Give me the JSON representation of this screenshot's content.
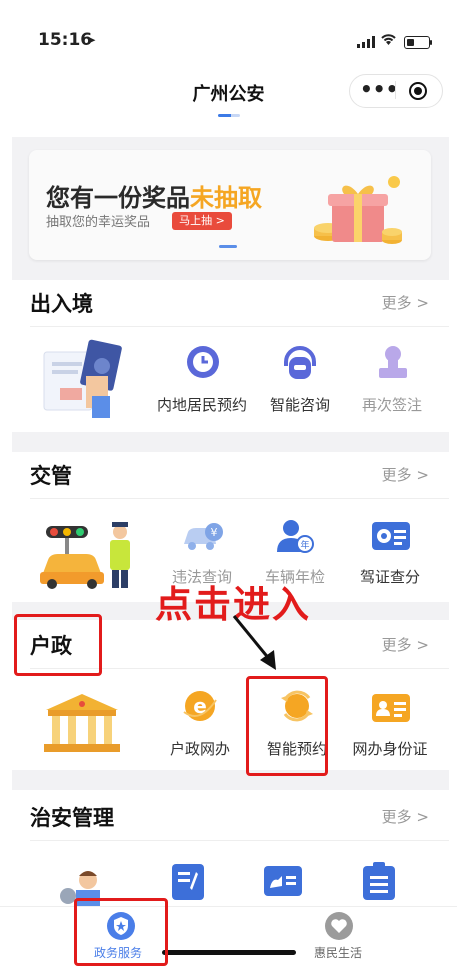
{
  "status_bar": {
    "time": "15:16",
    "location_arrow": "location-arrow-icon"
  },
  "nav": {
    "title": "广州公安",
    "more_glyph": "•••"
  },
  "banner": {
    "title_prefix": "您有一份奖品",
    "title_highlight": "未抽取",
    "subtitle": "抽取您的幸运奖品",
    "button": "马上抽 >",
    "highlight_color": "#f5a623",
    "button_color": "#e94b3c"
  },
  "sections": {
    "entry_exit": {
      "title": "出入境",
      "more": "更多 >",
      "items": [
        {
          "label": "内地居民预约"
        },
        {
          "label": "智能咨询"
        },
        {
          "label": "再次签注"
        }
      ]
    },
    "traffic": {
      "title": "交管",
      "more": "更多 >",
      "items": [
        {
          "label": "违法查询"
        },
        {
          "label": "车辆年检"
        },
        {
          "label": "驾证查分"
        }
      ]
    },
    "household": {
      "title": "户政",
      "more": "更多 >",
      "items": [
        {
          "label": "户政网办"
        },
        {
          "label": "智能预约"
        },
        {
          "label": "网办身份证"
        }
      ]
    },
    "security": {
      "title": "治安管理",
      "more": "更多 >"
    }
  },
  "annotation": {
    "text": "点击进入",
    "color": "#e21b1b"
  },
  "tabbar": {
    "items": [
      {
        "label": "政务服务",
        "icon": "shield-star-icon",
        "active": true
      },
      {
        "label": "惠民生活",
        "icon": "heart-icon",
        "active": false
      }
    ],
    "active_color": "#4a7ee8"
  }
}
